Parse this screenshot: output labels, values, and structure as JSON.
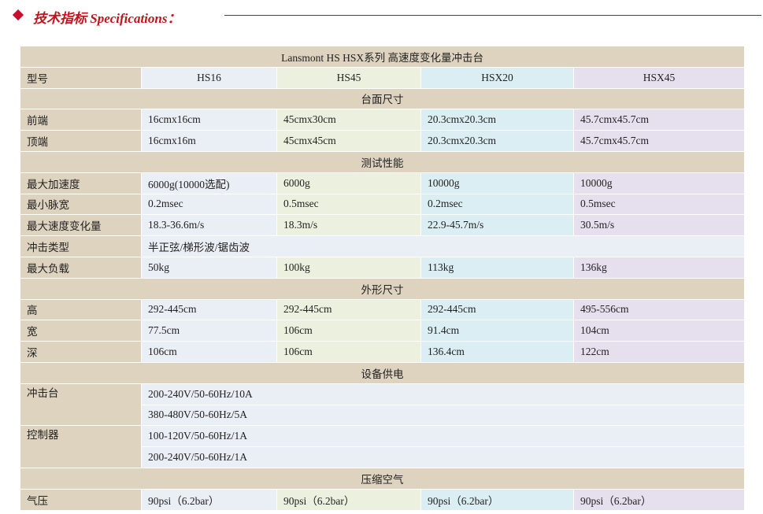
{
  "heading": "技术指标 Specifications：",
  "table": {
    "title": "Lansmont HS HSX系列 高速度变化量冲击台",
    "model_label": "型号",
    "models": [
      "HS16",
      "HS45",
      "HSX20",
      "HSX45"
    ],
    "sections": {
      "table_size": {
        "title": "台面尺寸",
        "rows": [
          {
            "label": "前端",
            "values": [
              "16cmx16cm",
              "45cmx30cm",
              "20.3cmx20.3cm",
              "45.7cmx45.7cm"
            ]
          },
          {
            "label": "顶端",
            "values": [
              "16cmx16m",
              "45cmx45cm",
              "20.3cmx20.3cm",
              "45.7cmx45.7cm"
            ]
          }
        ]
      },
      "performance": {
        "title": "测试性能",
        "rows": [
          {
            "label": "最大加速度",
            "values": [
              "6000g(10000选配)",
              "6000g",
              "10000g",
              "10000g"
            ]
          },
          {
            "label": "最小脉宽",
            "values": [
              "0.2msec",
              "0.5msec",
              "0.2msec",
              "0.5msec"
            ]
          },
          {
            "label": "最大速度变化量",
            "values": [
              "18.3-36.6m/s",
              "18.3m/s",
              "22.9-45.7m/s",
              "30.5m/s"
            ]
          }
        ],
        "shock_type": {
          "label": "冲击类型",
          "value": "半正弦/梯形波/锯齿波"
        },
        "max_load": {
          "label": "最大负载",
          "values": [
            "50kg",
            "100kg",
            "113kg",
            "136kg"
          ]
        }
      },
      "dimensions": {
        "title": "外形尺寸",
        "rows": [
          {
            "label": "高",
            "values": [
              "292-445cm",
              "292-445cm",
              "292-445cm",
              "495-556cm"
            ]
          },
          {
            "label": "宽",
            "values": [
              "77.5cm",
              "106cm",
              "91.4cm",
              "104cm"
            ]
          },
          {
            "label": "深",
            "values": [
              "106cm",
              "106cm",
              "136.4cm",
              "122cm"
            ]
          }
        ]
      },
      "power": {
        "title": "设备供电",
        "machine": {
          "label": "冲击台",
          "lines": [
            "200-240V/50-60Hz/10A",
            "380-480V/50-60Hz/5A"
          ]
        },
        "controller": {
          "label": "控制器",
          "lines": [
            "100-120V/50-60Hz/1A",
            "200-240V/50-60Hz/1A"
          ]
        }
      },
      "air": {
        "title": "压缩空气",
        "rows": [
          {
            "label": "气压",
            "values": [
              "90psi（6.2bar）",
              "90psi（6.2bar）",
              "90psi（6.2bar）",
              "90psi（6.2bar）"
            ]
          }
        ]
      }
    }
  },
  "colors": {
    "heading_red": "#c0141c",
    "label_tan": "#ddd3bf",
    "hs16_blue": "#eaeef5",
    "hs45_green": "#ecf1df",
    "hsx20_cyan": "#dbeef3",
    "hsx45_lavender": "#e6e0ee"
  }
}
